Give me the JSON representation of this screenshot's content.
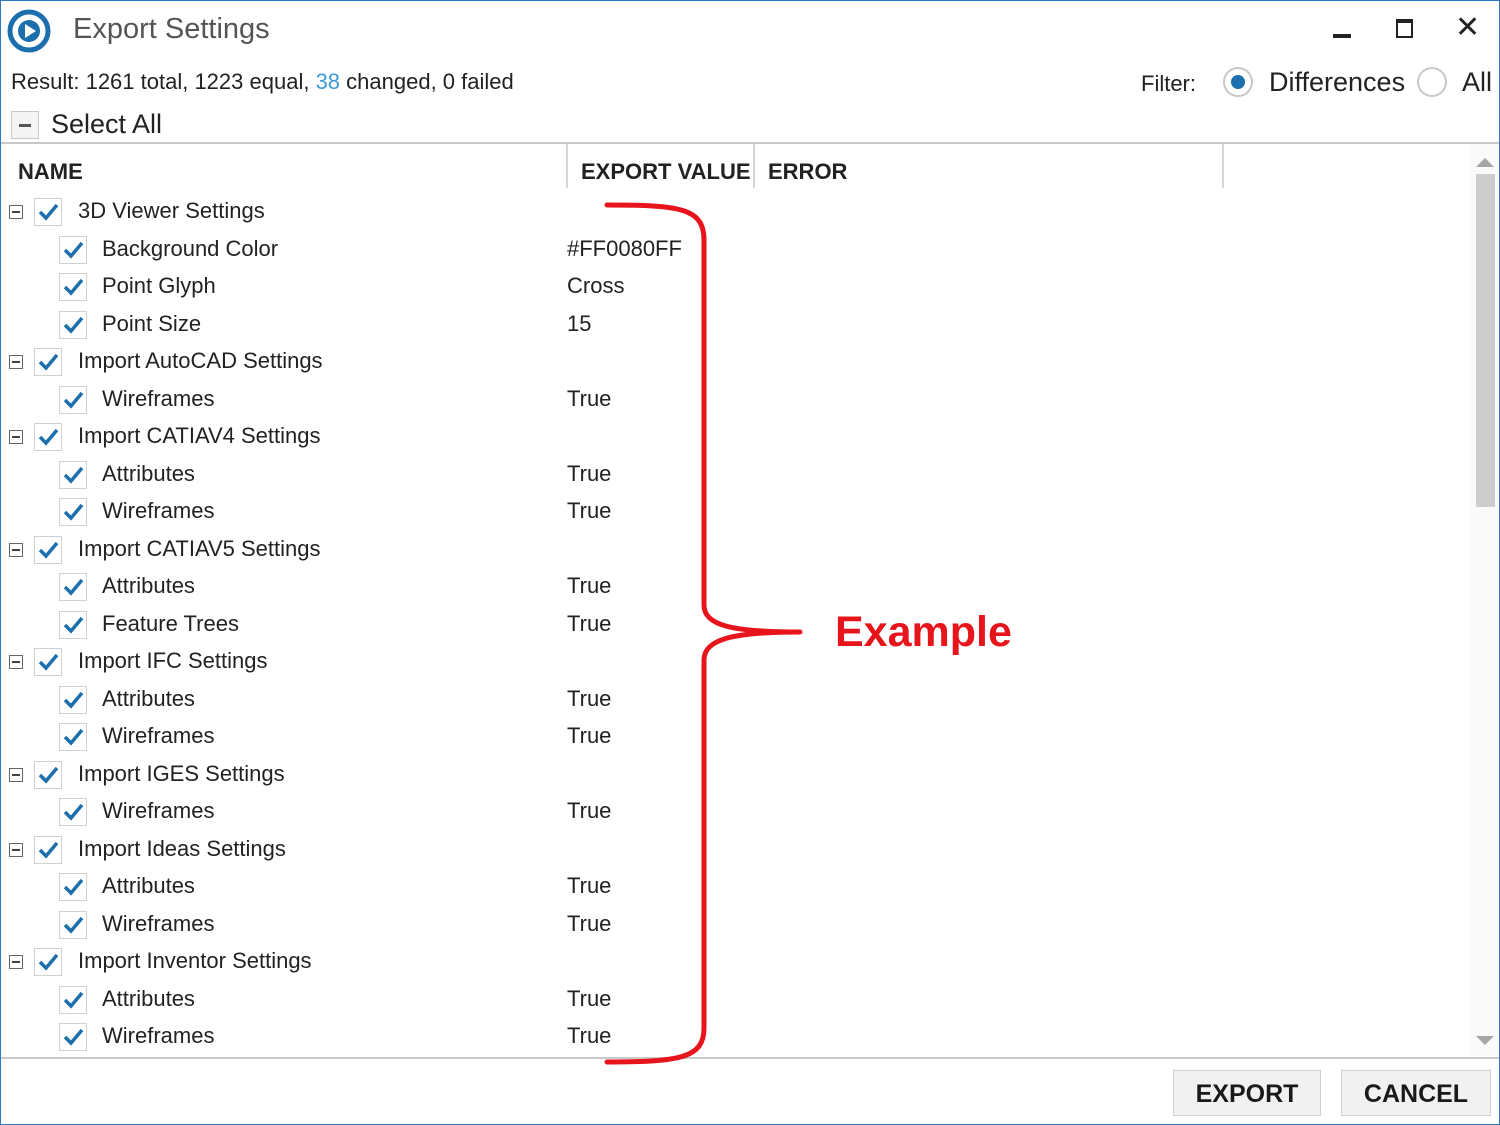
{
  "window": {
    "title": "Export Settings"
  },
  "status": {
    "prefix": "Result: 1261 total, 1223 equal, ",
    "changed": "38",
    "suffix": " changed, 0 failed"
  },
  "filter": {
    "label": "Filter:",
    "options": [
      {
        "label": "Differences",
        "selected": true
      },
      {
        "label": "All",
        "selected": false
      }
    ]
  },
  "select_all": {
    "label": "Select All",
    "state": "indeterminate"
  },
  "columns": [
    "NAME",
    "EXPORT VALUE",
    "ERROR"
  ],
  "tree": [
    {
      "level": "parent",
      "name": "3D Viewer Settings",
      "value": "",
      "checked": true,
      "expanded": true
    },
    {
      "level": "child",
      "name": "Background Color",
      "value": "#FF0080FF",
      "checked": true
    },
    {
      "level": "child",
      "name": "Point Glyph",
      "value": "Cross",
      "checked": true
    },
    {
      "level": "child",
      "name": "Point Size",
      "value": "15",
      "checked": true
    },
    {
      "level": "parent",
      "name": "Import AutoCAD Settings",
      "value": "",
      "checked": true,
      "expanded": true
    },
    {
      "level": "child",
      "name": "Wireframes",
      "value": "True",
      "checked": true
    },
    {
      "level": "parent",
      "name": "Import CATIAV4 Settings",
      "value": "",
      "checked": true,
      "expanded": true
    },
    {
      "level": "child",
      "name": "Attributes",
      "value": "True",
      "checked": true
    },
    {
      "level": "child",
      "name": "Wireframes",
      "value": "True",
      "checked": true
    },
    {
      "level": "parent",
      "name": "Import CATIAV5 Settings",
      "value": "",
      "checked": true,
      "expanded": true
    },
    {
      "level": "child",
      "name": "Attributes",
      "value": "True",
      "checked": true
    },
    {
      "level": "child",
      "name": "Feature Trees",
      "value": "True",
      "checked": true
    },
    {
      "level": "parent",
      "name": "Import IFC Settings",
      "value": "",
      "checked": true,
      "expanded": true
    },
    {
      "level": "child",
      "name": "Attributes",
      "value": "True",
      "checked": true
    },
    {
      "level": "child",
      "name": "Wireframes",
      "value": "True",
      "checked": true
    },
    {
      "level": "parent",
      "name": "Import IGES Settings",
      "value": "",
      "checked": true,
      "expanded": true
    },
    {
      "level": "child",
      "name": "Wireframes",
      "value": "True",
      "checked": true
    },
    {
      "level": "parent",
      "name": "Import Ideas Settings",
      "value": "",
      "checked": true,
      "expanded": true
    },
    {
      "level": "child",
      "name": "Attributes",
      "value": "True",
      "checked": true
    },
    {
      "level": "child",
      "name": "Wireframes",
      "value": "True",
      "checked": true
    },
    {
      "level": "parent",
      "name": "Import Inventor Settings",
      "value": "",
      "checked": true,
      "expanded": true
    },
    {
      "level": "child",
      "name": "Attributes",
      "value": "True",
      "checked": true
    },
    {
      "level": "child",
      "name": "Wireframes",
      "value": "True",
      "checked": true
    }
  ],
  "buttons": {
    "export": "EXPORT",
    "cancel": "CANCEL"
  },
  "annotation": {
    "label": "Example",
    "color": "#e8141b"
  },
  "colors": {
    "accent": "#1c6fad",
    "check": "#1c6fad",
    "changed_count": "#3b9bd8",
    "window_border": "#2b7cc4"
  },
  "icons": {
    "app": "app-logo-icon",
    "minimize": "minimize-icon",
    "maximize": "maximize-icon",
    "close": "close-icon",
    "expander": "collapse-icon",
    "checkbox": "checkmark-icon"
  }
}
